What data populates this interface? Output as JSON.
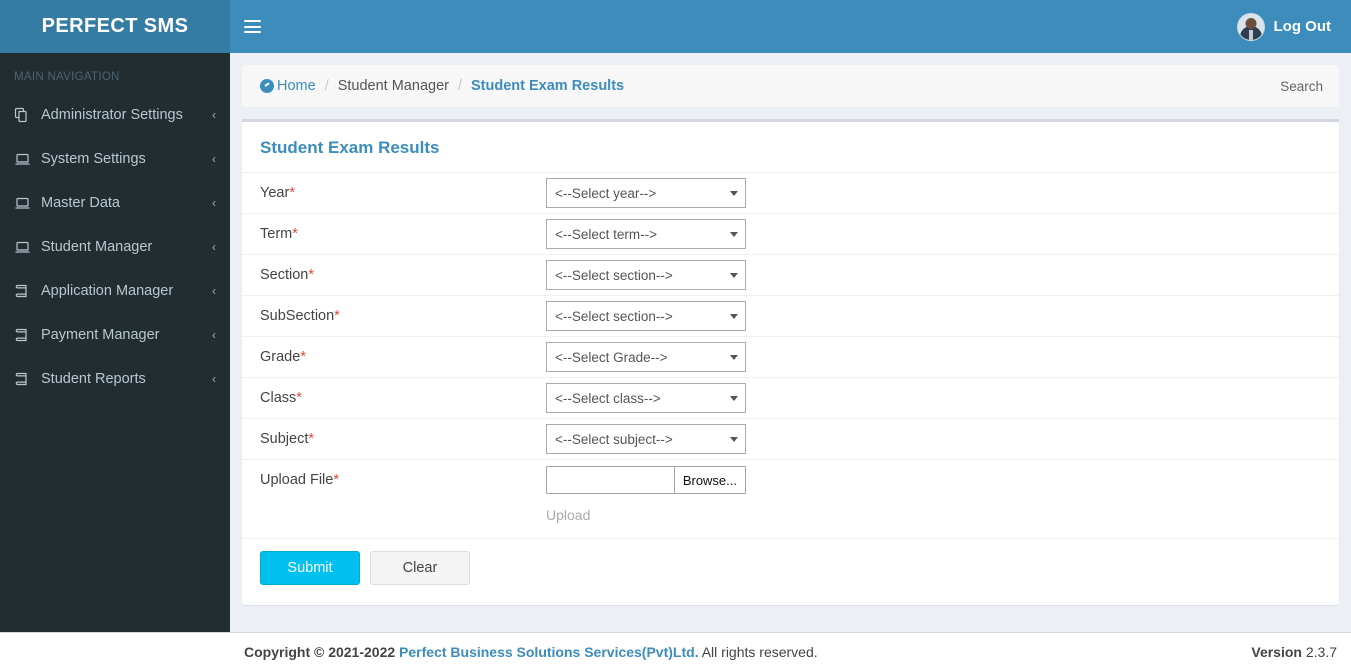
{
  "brand": {
    "title": "PERFECT SMS"
  },
  "topbar": {
    "menu_icon": "hamburger-icon",
    "avatar_icon": "user-avatar",
    "logout_label": "Log Out"
  },
  "sidebar": {
    "section_label": "MAIN NAVIGATION",
    "items": [
      {
        "label": "Administrator Settings",
        "icon": "copy-files-icon",
        "caret": "‹"
      },
      {
        "label": "System Settings",
        "icon": "laptop-icon",
        "caret": "‹"
      },
      {
        "label": "Master Data",
        "icon": "laptop-icon",
        "caret": "‹"
      },
      {
        "label": "Student Manager",
        "icon": "laptop-icon",
        "caret": "‹"
      },
      {
        "label": "Application Manager",
        "icon": "book-icon",
        "caret": "‹"
      },
      {
        "label": "Payment Manager",
        "icon": "book-icon",
        "caret": "‹"
      },
      {
        "label": "Student Reports",
        "icon": "book-icon",
        "caret": "‹"
      }
    ]
  },
  "breadcrumb": {
    "home_label": "Home",
    "home_icon": "dashboard-icon",
    "separator": "/",
    "middle_label": "Student Manager",
    "active_label": "Student Exam Results",
    "search_label": "Search"
  },
  "panel": {
    "title": "Student Exam Results",
    "required_marker": "*",
    "fields": [
      {
        "label": "Year",
        "required": true,
        "value": "<--Select year-->",
        "control": "select"
      },
      {
        "label": "Term",
        "required": true,
        "value": "<--Select term-->",
        "control": "select"
      },
      {
        "label": "Section",
        "required": true,
        "value": "<--Select section-->",
        "control": "select"
      },
      {
        "label": "SubSection",
        "required": true,
        "value": "<--Select section-->",
        "control": "select"
      },
      {
        "label": "Grade",
        "required": true,
        "value": "<--Select Grade-->",
        "control": "select"
      },
      {
        "label": "Class",
        "required": true,
        "value": "<--Select class-->",
        "control": "select"
      },
      {
        "label": "Subject",
        "required": true,
        "value": "<--Select subject-->",
        "control": "select"
      }
    ],
    "upload": {
      "label": "Upload File",
      "required": true,
      "file_value": "",
      "browse_label": "Browse...",
      "upload_link_label": "Upload"
    },
    "buttons": {
      "submit_label": "Submit",
      "clear_label": "Clear"
    }
  },
  "footer": {
    "copyright_prefix": "Copyright © 2021-2022",
    "company": "Perfect Business Solutions Services(Pvt)Ltd.",
    "rights": "All rights reserved.",
    "version_label": "Version",
    "version_number": "2.3.7"
  },
  "colors": {
    "brand_dark": "#357ca5",
    "brand": "#3c8dbc",
    "sidebar": "#222d32",
    "accent_cyan": "#00c0ef",
    "required_red": "#dd4b39",
    "page_bg": "#ecf0f5"
  }
}
